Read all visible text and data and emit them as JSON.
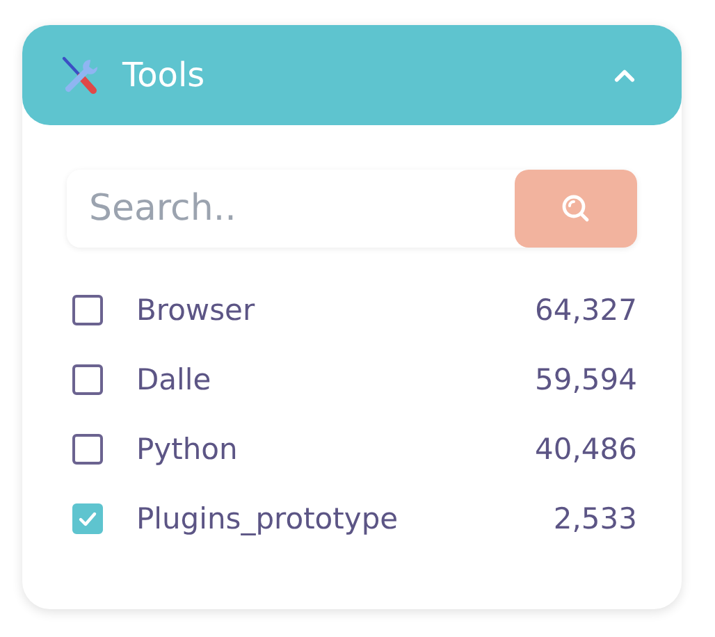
{
  "panel": {
    "title": "Tools",
    "expanded": true
  },
  "search": {
    "placeholder": "Search.."
  },
  "items": [
    {
      "label": "Browser",
      "count": "64,327",
      "checked": false
    },
    {
      "label": "Dalle",
      "count": "59,594",
      "checked": false
    },
    {
      "label": "Python",
      "count": "40,486",
      "checked": false
    },
    {
      "label": "Plugins_prototype",
      "count": "2,533",
      "checked": true
    }
  ]
}
